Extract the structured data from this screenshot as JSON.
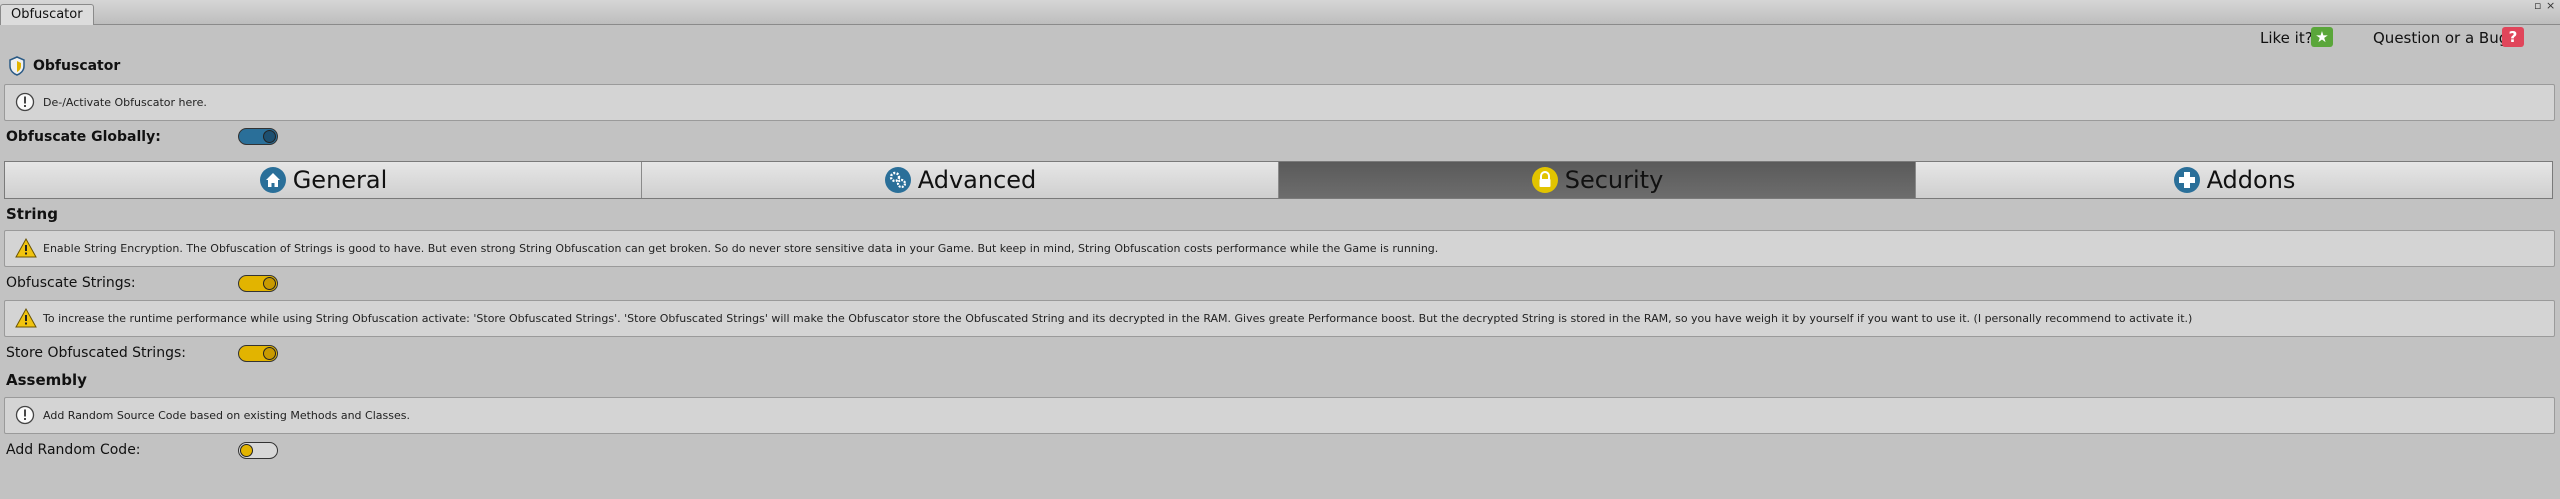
{
  "window": {
    "tab_title": "Obfuscator"
  },
  "header": {
    "like_label": "Like it?",
    "like_icon": "star-icon",
    "bug_label": "Question or a Bug?",
    "bug_icon": "question-icon",
    "like_color": "#5aa63a",
    "bug_color": "#e0455a"
  },
  "title": "Obfuscator",
  "intro": {
    "help_text": "De-/Activate Obfuscator here."
  },
  "global": {
    "label": "Obfuscate Globally:",
    "enabled": true,
    "color": "#2a6f99"
  },
  "tabs": [
    {
      "label": "General",
      "icon": "home-icon",
      "active": false
    },
    {
      "label": "Advanced",
      "icon": "gears-icon",
      "active": false
    },
    {
      "label": "Security",
      "icon": "lock-icon",
      "active": true
    },
    {
      "label": "Addons",
      "icon": "puzzle-icon",
      "active": false
    }
  ],
  "string_section": {
    "heading": "String",
    "warning1": "Enable String Encryption. The Obfuscation of Strings is good to have. But even strong String Obfuscation can get broken. So do never store sensitive data in your Game. But keep in mind, String Obfuscation costs performance while the Game is running.",
    "obfuscate_label": "Obfuscate Strings:",
    "obfuscate_enabled": true,
    "warning2": "To increase the runtime performance while using String Obfuscation activate: 'Store Obfuscated Strings'. 'Store Obfuscated Strings' will make the Obfuscator store the Obfuscated String and its decrypted in the RAM. Gives greate Performance boost. But the decrypted String is stored in the RAM, so you have weigh it by yourself if you want to use it. (I personally recommend to activate it.)",
    "store_label": "Store Obfuscated Strings:",
    "store_enabled": true,
    "toggle_color": "#e2b400"
  },
  "assembly_section": {
    "heading": "Assembly",
    "info": "Add Random Source Code based on existing Methods and Classes.",
    "random_label": "Add Random Code:",
    "random_enabled": false
  }
}
